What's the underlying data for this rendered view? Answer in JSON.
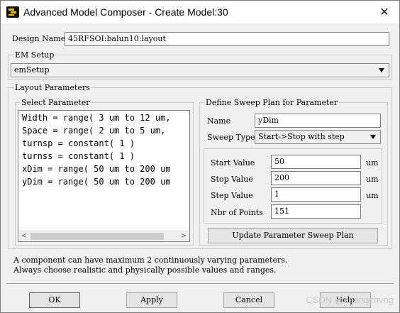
{
  "window": {
    "title": "Advanced Model Composer - Create Model:30",
    "close_icon": "close-icon",
    "app_icon": "app-logo-icon"
  },
  "design_name": {
    "label": "Design Name",
    "value": "45RFSOI:balun10:layout"
  },
  "em_setup": {
    "title": "EM Setup",
    "selected": "emSetup"
  },
  "layout_parameters": {
    "title": "Layout Parameters",
    "select_parameter": {
      "title": "Select Parameter",
      "items": [
        "Width = range( 3 um to 12 um,",
        "Space = range( 2 um to 5 um,",
        "turnsp = constant( 1 )",
        "turnss = constant( 1 )",
        "xDim = range( 50 um to 200 um",
        "yDim = range( 50 um to 200 um"
      ]
    },
    "sweep_plan": {
      "title": "Define Sweep Plan for Parameter",
      "name_label": "Name",
      "name_value": "yDim",
      "sweep_type_label": "Sweep Type",
      "sweep_type_value": "Start->Stop with step",
      "start_label": "Start Value",
      "start_value": "50",
      "start_unit": "um",
      "stop_label": "Stop Value",
      "stop_value": "200",
      "stop_unit": "um",
      "step_label": "Step Value",
      "step_value": "1",
      "step_unit": "um",
      "points_label": "Nbr of Points",
      "points_value": "151",
      "update_button": "Update Parameter Sweep Plan"
    }
  },
  "notes": {
    "line1": "A component can have maximum 2 continuously varying parameters.",
    "line2": "Always choose realistic and physically possible values and ranges."
  },
  "buttons": {
    "ok": "OK",
    "apply": "Apply",
    "cancel": "Cancel",
    "help": "Help"
  },
  "watermark": "CSDN @zhangchvng"
}
